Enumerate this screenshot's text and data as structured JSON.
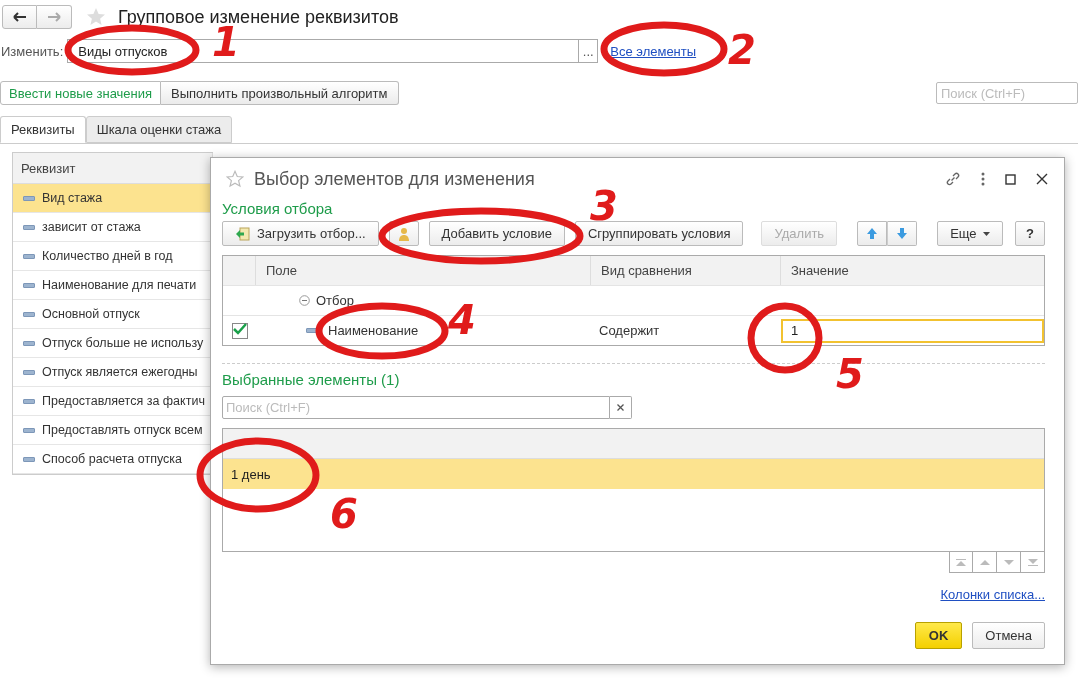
{
  "window": {
    "title": "Групповое изменение реквизитов"
  },
  "object_field": {
    "label": "Изменить:",
    "value": "Виды отпусков",
    "button": "...",
    "link": "Все элементы"
  },
  "actions": [
    {
      "label": "Ввести новые значения",
      "selected": true
    },
    {
      "label": "Выполнить произвольный алгоритм",
      "selected": false
    }
  ],
  "search": {
    "placeholder": "Поиск (Ctrl+F)"
  },
  "tabs": [
    {
      "label": "Реквизиты",
      "selected": true
    },
    {
      "label": "Шкала оценки стажа",
      "selected": false
    }
  ],
  "table": {
    "columns": [
      "Реквизит"
    ],
    "rows": [
      {
        "name": "Вид стажа",
        "selected": true
      },
      {
        "name": "зависит от стажа",
        "selected": false
      },
      {
        "name": "Количество дней в год",
        "selected": false
      },
      {
        "name": "Наименование для печати",
        "selected": false
      },
      {
        "name": "Основной отпуск",
        "selected": false
      },
      {
        "name": "Отпуск больше не использу",
        "selected": false
      },
      {
        "name": "Отпуск является ежегодны",
        "selected": false
      },
      {
        "name": "Предоставляется за фактич",
        "selected": false
      },
      {
        "name": "Предоставлять отпуск всем",
        "selected": false
      },
      {
        "name": "Способ расчета отпуска",
        "selected": false
      }
    ]
  },
  "dialog": {
    "title": "Выбор элементов для изменения",
    "filter_heading": "Условия отбора",
    "toolbar": [
      {
        "kind": "load",
        "label": "Загрузить отбор..."
      },
      {
        "kind": "icon"
      },
      {
        "kind": "text",
        "label": "Добавить условие",
        "disabled": false
      },
      {
        "kind": "text",
        "label": "Сгруппировать условия",
        "disabled": false
      },
      {
        "kind": "text",
        "label": "Удалить",
        "disabled": true
      },
      {
        "kind": "arrows"
      },
      {
        "kind": "menu",
        "label": "Еще"
      },
      {
        "kind": "help",
        "label": "?"
      }
    ],
    "conditions": {
      "columns": [
        "Поле",
        "Вид сравнения",
        "Значение"
      ],
      "rows": [
        {
          "kind": "group",
          "field": "Отбор",
          "expanded": true
        },
        {
          "kind": "condition",
          "checked": true,
          "field": "Наименование",
          "comparison": "Содержит",
          "value": "1"
        }
      ]
    },
    "selected_heading": "Выбранные элементы (1)",
    "selected_search": {
      "placeholder": "Поиск (Ctrl+F)"
    },
    "selected_list": {
      "rows": [
        {
          "text": "1 день",
          "selected": true
        }
      ]
    },
    "columns_link": "Колонки списка...",
    "buttons": [
      {
        "label": "OK",
        "kind": "primary"
      },
      {
        "label": "Отмена",
        "kind": "default"
      }
    ]
  },
  "annotations": [
    {
      "label": "1"
    },
    {
      "label": "2"
    },
    {
      "label": "3"
    },
    {
      "label": "4"
    },
    {
      "label": "5"
    },
    {
      "label": "6"
    }
  ]
}
